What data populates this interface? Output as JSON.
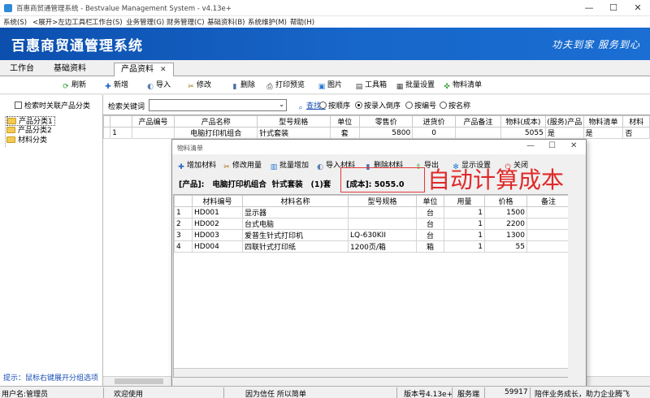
{
  "window": {
    "title": "百惠商贸通管理系统 - Bestvalue Management System - v4.13e+",
    "minimize": "—",
    "maximize": "☐",
    "close": "✕"
  },
  "menu": [
    "系统(S)",
    "<展开>左边工具栏",
    "工作台(S)",
    "业务管理(G)",
    "财务管理(C)",
    "基础资料(B)",
    "系统维护(M)",
    "帮助(H)"
  ],
  "banner": {
    "title": "百惠商贸通管理系统",
    "slogan": "功夫到家 服务到心"
  },
  "tabs": [
    "工作台",
    "基础资料",
    "产品资料"
  ],
  "tab_close": "✕",
  "toolbar": {
    "refresh": "刷新",
    "add": "新增",
    "import": "导入",
    "edit": "修改",
    "delete": "删除",
    "print_preview": "打印预览",
    "image": "图片",
    "toolbox": "工具箱",
    "batch_settings": "批量设置",
    "material_list": "物料清单"
  },
  "left_panel": {
    "checkbox_label": "检索时关联产品分类",
    "tree": [
      "产品分类1",
      "产品分类2",
      "材料分类"
    ],
    "hint": "提示：鼠标右键展开分组选项"
  },
  "search": {
    "label": "检索关键词",
    "value": "",
    "find": "查找..",
    "options": [
      "按顺序",
      "按录入倒序",
      "按编号",
      "按名称"
    ],
    "selected": "按录入倒序"
  },
  "grid": {
    "columns": [
      "",
      "产品编号",
      "产品名称",
      "型号规格",
      "单位",
      "零售价",
      "进货价",
      "产品备注",
      "物料(成本)",
      "(服务)产品",
      "物料清单",
      "材料"
    ],
    "rows": [
      [
        "1",
        "",
        "电脑打印机组合",
        "针式套装",
        "套",
        "5800",
        "0",
        "",
        "5055",
        "是",
        "是",
        "否"
      ]
    ]
  },
  "dialog": {
    "title": "物料清单",
    "toolbar": {
      "add": "增加材料",
      "edit_qty": "修改用量",
      "batch_add": "批量增加",
      "import": "导入材料",
      "delete": "删除材料",
      "export": "导出",
      "display": "显示设置",
      "close": "关闭"
    },
    "info": {
      "product_label": "[产品]:",
      "product_name": "电脑打印机组合",
      "product_spec": "针式套装",
      "product_qty": "(1)套",
      "cost": "[成本]: 5055.0"
    },
    "columns": [
      "",
      "材料编号",
      "材料名称",
      "型号规格",
      "单位",
      "用量",
      "价格",
      "备注"
    ],
    "rows": [
      [
        "1",
        "HD001",
        "显示器",
        "",
        "台",
        "1",
        "1500",
        ""
      ],
      [
        "2",
        "HD002",
        "台式电脑",
        "",
        "台",
        "1",
        "2200",
        ""
      ],
      [
        "3",
        "HD003",
        "爱普生针式打印机",
        "LQ-630KII",
        "台",
        "1",
        "1300",
        ""
      ],
      [
        "4",
        "HD004",
        "四联针式打印纸",
        "1200页/箱",
        "箱",
        "1",
        "55",
        ""
      ]
    ]
  },
  "callout": "自动计算成本",
  "status": {
    "user": "用户名:管理员",
    "welcome": "欢迎使用",
    "motto": "因为信任 所以简单",
    "version": "版本号4.13e+",
    "client": "服务端",
    "port": "59917",
    "slogan": "陪伴业务成长，助力企业腾飞"
  },
  "colors": {
    "banner": "#1766c9",
    "callout": "#e02828",
    "hint": "#1a4fb5"
  }
}
